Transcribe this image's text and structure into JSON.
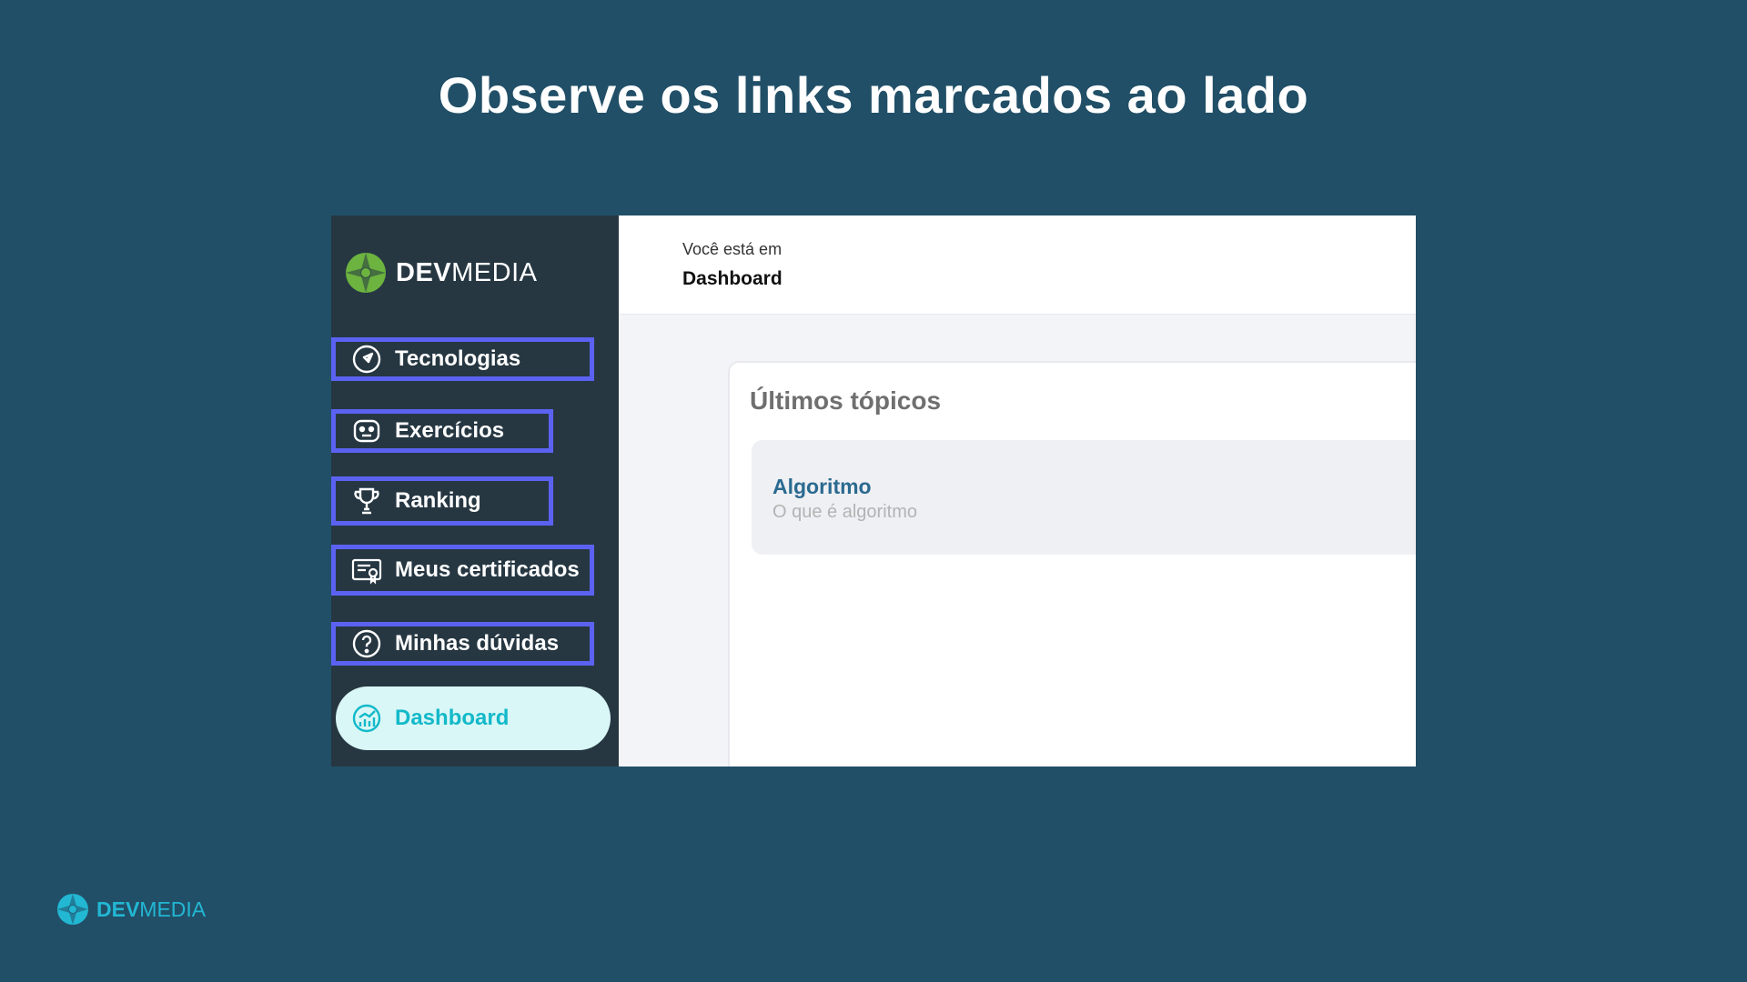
{
  "slide": {
    "title": "Observe os links marcados ao lado"
  },
  "app": {
    "logo": {
      "bold": "DEV",
      "light": "MEDIA"
    },
    "sidebar": {
      "items": [
        {
          "label": "Tecnologias",
          "icon": "compass-icon",
          "highlighted": true
        },
        {
          "label": "Exercícios",
          "icon": "robot-icon",
          "highlighted": true
        },
        {
          "label": "Ranking",
          "icon": "trophy-icon",
          "highlighted": true
        },
        {
          "label": "Meus certificados",
          "icon": "certificate-icon",
          "highlighted": true
        },
        {
          "label": "Minhas dúvidas",
          "icon": "question-icon",
          "highlighted": true
        }
      ],
      "active_item": {
        "label": "Dashboard",
        "icon": "dashboard-chart-icon"
      },
      "highlight_color": "#5b62f1",
      "active_color": "#12b9c9"
    },
    "header": {
      "breadcrumb_label": "Você está em",
      "current_page": "Dashboard"
    },
    "card": {
      "title": "Últimos tópicos",
      "topics": [
        {
          "title": "Algoritmo",
          "description": "O que é algoritmo"
        }
      ]
    }
  },
  "footer_brand": {
    "bold": "DEV",
    "light": "MEDIA"
  },
  "colors": {
    "background": "#214f67",
    "sidebar": "#263742",
    "logo_green": "#6cb33f",
    "footer_brand": "#22b7d3"
  }
}
